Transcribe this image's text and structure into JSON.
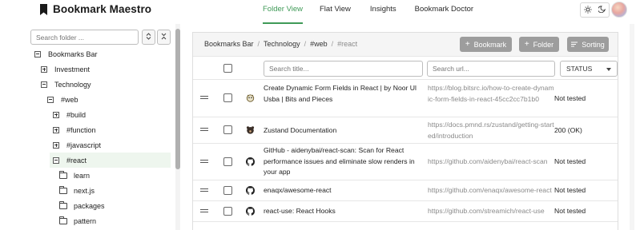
{
  "app": {
    "title": "Bookmark Maestro"
  },
  "nav": {
    "tabs": [
      {
        "label": "Folder View",
        "active": true
      },
      {
        "label": "Flat View",
        "active": false
      },
      {
        "label": "Insights",
        "active": false
      },
      {
        "label": "Bookmark Doctor",
        "active": false
      }
    ]
  },
  "theme": {
    "light_icon": "sun-icon",
    "dark_icon": "moon-icon"
  },
  "sidebar": {
    "search": {
      "placeholder": "Search folder ..."
    },
    "expand_icon": "chevron-up-down-icon",
    "collapse_icon": "chevrons-collapse-icon",
    "tree": [
      {
        "label": "Bookmarks Bar",
        "icon": "minus-square-icon",
        "level": 0
      },
      {
        "label": "Investment",
        "icon": "plus-square-icon",
        "level": 1
      },
      {
        "label": "Technology",
        "icon": "minus-square-icon",
        "level": 1
      },
      {
        "label": "#web",
        "icon": "minus-square-icon",
        "level": 2
      },
      {
        "label": "#build",
        "icon": "plus-square-icon",
        "level": 3
      },
      {
        "label": "#function",
        "icon": "plus-square-icon",
        "level": 3
      },
      {
        "label": "#javascript",
        "icon": "plus-square-icon",
        "level": 3
      },
      {
        "label": "#react",
        "icon": "minus-square-icon",
        "level": 3,
        "selected": true
      },
      {
        "label": "learn",
        "icon": "folder-icon",
        "level": 4
      },
      {
        "label": "next.js",
        "icon": "folder-icon",
        "level": 4
      },
      {
        "label": "packages",
        "icon": "folder-icon",
        "level": 4
      },
      {
        "label": "pattern",
        "icon": "folder-icon",
        "level": 4
      }
    ]
  },
  "main": {
    "breadcrumb": [
      "Bookmarks Bar",
      "Technology",
      "#web",
      "#react"
    ],
    "actions": [
      {
        "label": "Bookmark",
        "icon": "plus-icon"
      },
      {
        "label": "Folder",
        "icon": "plus-icon"
      },
      {
        "label": "Sorting",
        "icon": "sort-icon"
      }
    ],
    "filters": {
      "title_placeholder": "Search title...",
      "url_placeholder": "Search url...",
      "status_value": "STATUS"
    },
    "rows": [
      {
        "title": "Create Dynamic Form Fields in React | by Noor Ul Usba | Bits and Pieces",
        "url": "https://blog.bitsrc.io/how-to-create-dynamic-form-fields-in-react-45cc2cc7b1b0",
        "status": "Not tested",
        "favicon": "bit-logo-icon"
      },
      {
        "title": "Zustand Documentation",
        "url": "https://docs.pmnd.rs/zustand/getting-started/introduction",
        "status": "200 (OK)",
        "favicon": "bear-icon"
      },
      {
        "title": "GitHub - aidenybai/react-scan: Scan for React performance issues and eliminate slow renders in your app",
        "url": "https://github.com/aidenybai/react-scan",
        "status": "Not tested",
        "favicon": "github-icon"
      },
      {
        "title": "enaqx/awesome-react",
        "url": "https://github.com/enaqx/awesome-react",
        "status": "Not tested",
        "favicon": "github-icon"
      },
      {
        "title": "react-use: React Hooks",
        "url": "https://github.com/streamich/react-use",
        "status": "Not tested",
        "favicon": "github-icon"
      }
    ]
  },
  "colors": {
    "accent": "#3f9a57",
    "button": "#9d9d9d",
    "muted_text": "#8a8a8a"
  }
}
